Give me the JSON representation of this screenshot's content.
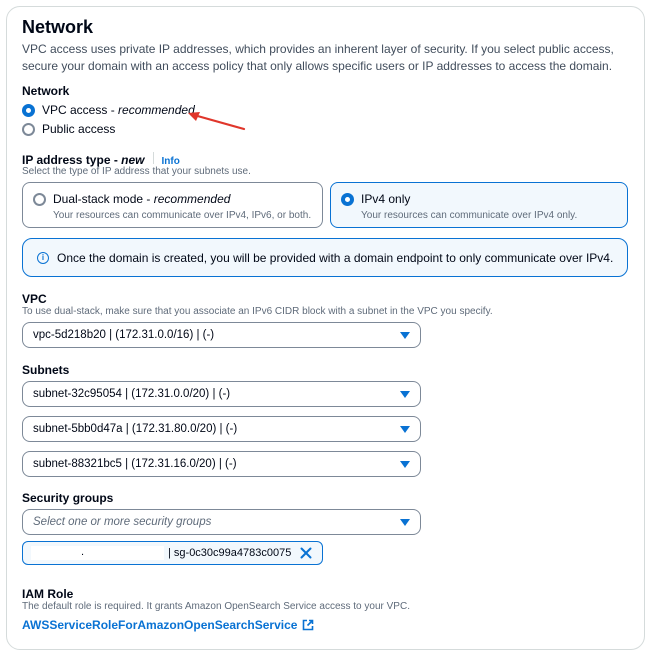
{
  "section": {
    "title": "Network",
    "description": "VPC access uses private IP addresses, which provides an inherent layer of security. If you select public access, secure your domain with an access policy that only allows specific users or IP addresses to access the domain."
  },
  "network": {
    "label": "Network",
    "options": [
      {
        "label": "VPC access",
        "suffix": " - ",
        "emph": "recommended",
        "selected": true
      },
      {
        "label": "Public access",
        "selected": false
      }
    ]
  },
  "ip_type": {
    "label": "IP address type",
    "label_suffix": " - ",
    "label_emph": "new",
    "info": "Info",
    "description": "Select the type of IP address that your subnets use.",
    "tiles": [
      {
        "title": "Dual-stack mode",
        "suffix": " - ",
        "emph": "recommended",
        "desc": "Your resources can communicate over IPv4, IPv6, or both.",
        "selected": false
      },
      {
        "title": "IPv4 only",
        "desc": "Your resources can communicate over IPv4 only.",
        "selected": true
      }
    ]
  },
  "alert": {
    "icon": "info-icon",
    "text": "Once the domain is created, you will be provided with a domain endpoint to only communicate over IPv4."
  },
  "vpc": {
    "label": "VPC",
    "description": "To use dual-stack, make sure that you associate an IPv6 CIDR block with a subnet in the VPC you specify.",
    "value": "vpc-5d218b20 | (172.31.0.0/16) | (-)"
  },
  "subnets": {
    "label": "Subnets",
    "values": [
      "subnet-32c95054 | (172.31.0.0/20) | (-)",
      "subnet-5bb0d47a | (172.31.80.0/20) | (-)",
      "subnet-88321bc5 | (172.31.16.0/20) | (-)"
    ]
  },
  "security_groups": {
    "label": "Security groups",
    "placeholder": "Select one or more security groups",
    "token_prefix": ".",
    "token_text": "| sg-0c30c99a4783c0075",
    "remove_icon": "close-icon"
  },
  "iam": {
    "label": "IAM Role",
    "description": "The default role is required. It grants Amazon OpenSearch Service access to your VPC.",
    "link": "AWSServiceRoleForAmazonOpenSearchService",
    "link_icon": "external-link-icon"
  },
  "colors": {
    "accent": "#0972d3",
    "annotation_arrow": "#e0362b"
  }
}
